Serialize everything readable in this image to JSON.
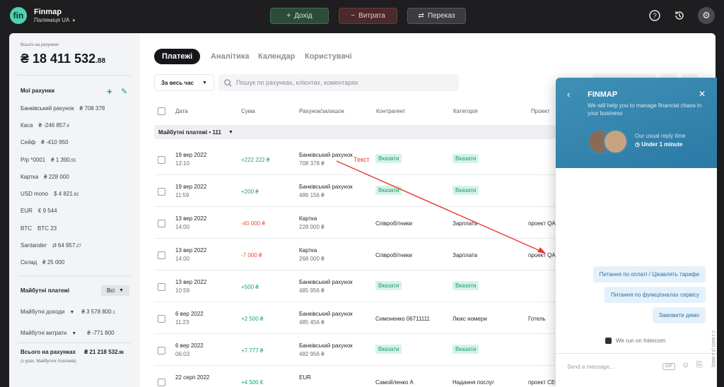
{
  "app": {
    "brand": "Finmap",
    "org": "Паляниця UA",
    "logo_text": "fin"
  },
  "topbar": {
    "income_label": "Дохід",
    "expense_label": "Витрата",
    "transfer_label": "Переказ",
    "icons": [
      "help-icon",
      "history-icon",
      "settings-icon"
    ]
  },
  "sidebar": {
    "total_label": "Всього на рахунках",
    "total_main": "₴ 18 411 532",
    "total_cents": ".88",
    "accounts_title": "Мої рахунки",
    "accounts": [
      {
        "name": "Банківський рахунок",
        "value": "₴ 708 378",
        "cents": ""
      },
      {
        "name": "Каса",
        "value": "₴ -246 857",
        "cents": ".4"
      },
      {
        "name": "Сейф",
        "value": "₴ -410 950",
        "cents": ""
      },
      {
        "name": "Р/р *0001",
        "value": "₴ 1 390",
        "cents": ".55"
      },
      {
        "name": "Картка",
        "value": "₴ 228 000",
        "cents": ""
      },
      {
        "name": "USD mono",
        "value": "$ 4 821",
        "cents": ".82"
      },
      {
        "name": "EUR",
        "value": "€ 9 544",
        "cents": ""
      },
      {
        "name": "BTC",
        "value": "BTC 23",
        "cents": ""
      },
      {
        "name": "Santander",
        "value": "zł 64 957",
        "cents": ".27"
      },
      {
        "name": "Склад",
        "value": "₴ 25 000",
        "cents": ""
      }
    ],
    "future_title": "Майбутні платежі",
    "future_select": "Всі",
    "future_income_label": "Майбутні доходи",
    "future_income_value": "₴ 3 578 800",
    "future_income_cents": ".1",
    "future_expense_label": "Майбутні витрати",
    "future_expense_value": "₴ -771 800",
    "grand_label": "Всього на рахунках",
    "grand_value": "₴ 21 218 532",
    "grand_cents": ".98",
    "grand_note": "(з урах. Майбутніх платежів)"
  },
  "tabs": [
    "Платежі",
    "Аналітика",
    "Календар",
    "Користувачі"
  ],
  "filters": {
    "period": "За весь час",
    "search_placeholder": "Пошук по рахунках, клієнтах, коментарях"
  },
  "table": {
    "headers": [
      "Дата",
      "Сума",
      "Рахунок/залишок",
      "Контрагент",
      "Категорія",
      "Проект"
    ],
    "future_group": "Майбутні платежі • 111",
    "rows": [
      {
        "date": "19 вер 2022",
        "time": "12:10",
        "amount": "+222 222 ₴",
        "sign": "pos",
        "account": "Банківський рахунок",
        "balance": "708 378 ₴",
        "counterparty": "Вказати",
        "cp_tag": true,
        "category": "Вказати",
        "cat_tag": true,
        "project": ""
      },
      {
        "date": "19 вер 2022",
        "time": "11:59",
        "amount": "+200 ₴",
        "sign": "pos",
        "account": "Банківський рахунок",
        "balance": "486 156 ₴",
        "counterparty": "Вказати",
        "cp_tag": true,
        "category": "Вказати",
        "cat_tag": true,
        "project": ""
      },
      {
        "date": "13 вер 2022",
        "time": "14:00",
        "amount": "-40 000 ₴",
        "sign": "neg",
        "account": "Картка",
        "balance": "228 000 ₴",
        "counterparty": "Співробітники",
        "cp_tag": false,
        "category": "Зарплата",
        "cat_tag": false,
        "project": "проект QA"
      },
      {
        "date": "13 вер 2022",
        "time": "14:00",
        "amount": "-7 000 ₴",
        "sign": "neg",
        "account": "Картка",
        "balance": "268 000 ₴",
        "counterparty": "Співробітники",
        "cp_tag": false,
        "category": "Зарплата",
        "cat_tag": false,
        "project": "проект QA"
      },
      {
        "date": "13 вер 2022",
        "time": "10:59",
        "amount": "+500 ₴",
        "sign": "pos",
        "account": "Банківський рахунок",
        "balance": "485 956 ₴",
        "counterparty": "Вказати",
        "cp_tag": true,
        "category": "Вказати",
        "cat_tag": true,
        "project": ""
      },
      {
        "date": "6 вер 2022",
        "time": "11:23",
        "amount": "+2 500 ₴",
        "sign": "pos",
        "account": "Банківський рахунок",
        "balance": "485 456 ₴",
        "counterparty": "Симоненко 06711111",
        "cp_tag": false,
        "category": "Люкс номери",
        "cat_tag": false,
        "project": "Готель"
      },
      {
        "date": "6 вер 2022",
        "time": "06:03",
        "amount": "+7 777 ₴",
        "sign": "pos",
        "account": "Банківський рахунок",
        "balance": "482 956 ₴",
        "counterparty": "Вказати",
        "cp_tag": true,
        "category": "Вказати",
        "cat_tag": true,
        "project": ""
      },
      {
        "date": "22 серп 2022",
        "time": "",
        "amount": "+4 500 €",
        "sign": "pos",
        "account": "EUR",
        "balance": "",
        "counterparty": "Самойленко А",
        "cp_tag": false,
        "category": "Надання послуг",
        "cat_tag": false,
        "project": "проект CEO"
      }
    ]
  },
  "annotation": {
    "text": "Текст",
    "color": "#e8372b"
  },
  "chat": {
    "title": "FINMAP",
    "subtitle": "We will help you to manage financial chaos in your business",
    "reply_label": "Our usual reply time",
    "reply_value": "Under 1 minute",
    "quick_replies": [
      "Питання по оплаті / Цікавлять тарифи",
      "Питання по функціоналах сервісу",
      "Замовити демо"
    ],
    "powered": "We run on Intercom",
    "placeholder": "Send a message...",
    "gif_label": "GIF"
  },
  "version": "2.1.6693 (2.1.6693)"
}
